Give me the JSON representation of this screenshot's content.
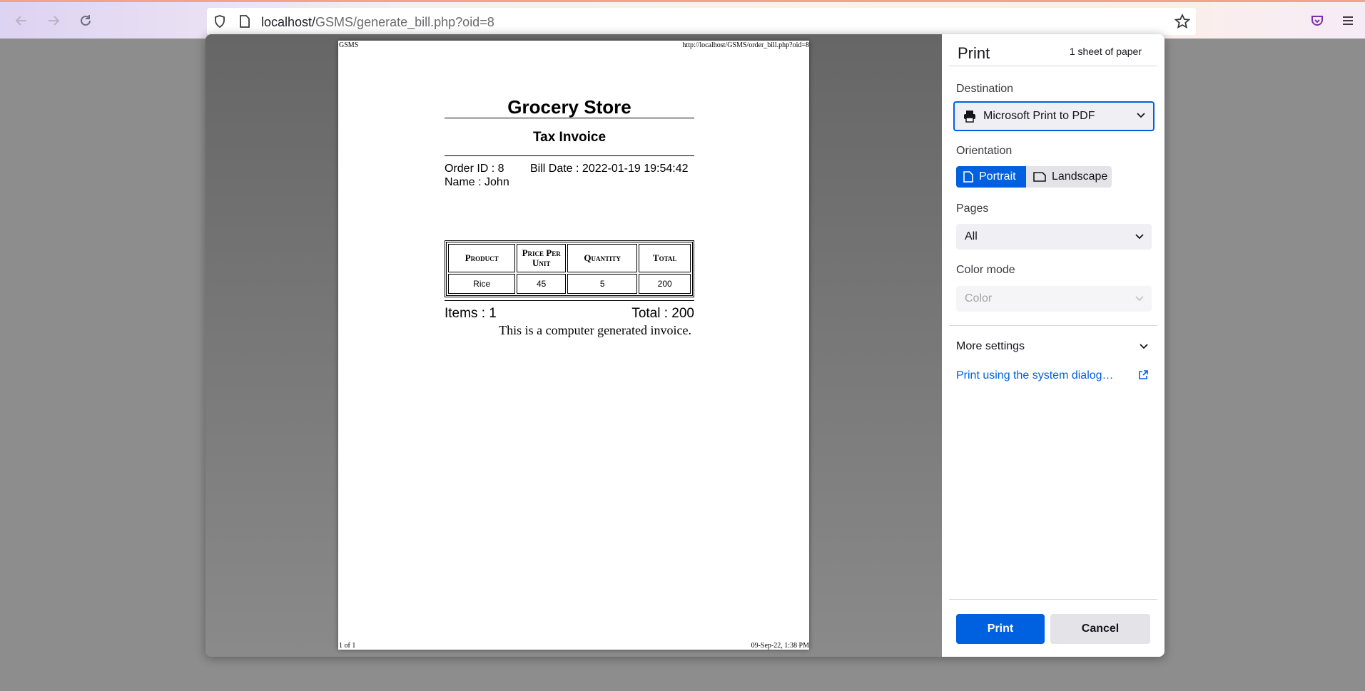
{
  "browser": {
    "url_host": "localhost/",
    "url_path": "GSMS/generate_bill.php?oid=8"
  },
  "page_header": {
    "left": "GSMS",
    "right": "http://localhost/GSMS/order_bill.php?oid=8"
  },
  "page_footer": {
    "left": "1 of 1",
    "right": "09-Sep-22, 1:38 PM"
  },
  "invoice": {
    "store_name": "Grocery Store",
    "doc_title": "Tax Invoice",
    "order_id": "Order ID : 8",
    "bill_date": "Bill Date : 2022-01-19 19:54:42",
    "customer": "Name : John",
    "columns": [
      "Product",
      "Price Per Unit",
      "Quantity",
      "Total"
    ],
    "rows": [
      {
        "product": "Rice",
        "price": "45",
        "quantity": "5",
        "total": "200"
      }
    ],
    "items_count": "Items : 1",
    "total": "Total : 200",
    "footer_note": "This is a computer generated invoice."
  },
  "print_panel": {
    "title": "Print",
    "sheets": "1 sheet of paper",
    "destination_label": "Destination",
    "destination_value": "Microsoft Print to PDF",
    "orientation_label": "Orientation",
    "portrait": "Portrait",
    "landscape": "Landscape",
    "pages_label": "Pages",
    "pages_value": "All",
    "color_label": "Color mode",
    "color_value": "Color",
    "more_settings": "More settings",
    "system_dialog": "Print using the system dialog…",
    "print_button": "Print",
    "cancel_button": "Cancel"
  },
  "colors": {
    "accent": "#0061e0",
    "panel_bg": "#ffffff",
    "backdrop": "#8d8d8d"
  }
}
